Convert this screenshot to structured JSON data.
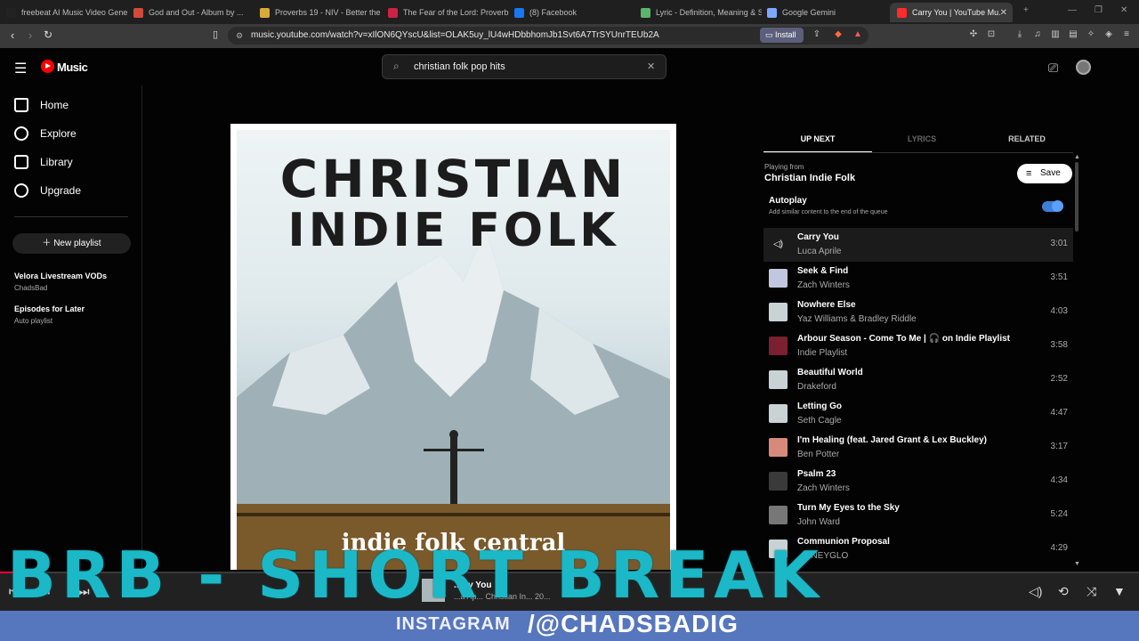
{
  "browser": {
    "tabs": [
      {
        "title": "freebeat AI Music Video Generator",
        "color": "#222222"
      },
      {
        "title": "God and Out - Album by ...",
        "color": "#d14a3a"
      },
      {
        "title": "Proverbs 19 - NIV - Better the...",
        "color": "#d9a93a"
      },
      {
        "title": "The Fear of the Lord: Proverbs",
        "color": "#cc2244"
      },
      {
        "title": "(8) Facebook",
        "color": "#1877f2"
      },
      {
        "title": "Lyric - Definition, Meaning & S...",
        "color": "#5bb56a"
      },
      {
        "title": "Google Gemini",
        "color": "#7ea7ff"
      },
      {
        "title": "Carry You | YouTube Mu...",
        "color": "#ff2b2b",
        "active": true
      }
    ],
    "url": "music.youtube.com/watch?v=xIlON6QYscU&list=OLAK5uy_lU4wHDbbhomJb1Svt6A7TrSYUnrTEUb2A",
    "install_label": "Install"
  },
  "app": {
    "logo_label": "Music",
    "search_query": "christian folk pop hits"
  },
  "sidebar": {
    "items": [
      {
        "label": "Home"
      },
      {
        "label": "Explore"
      },
      {
        "label": "Library"
      },
      {
        "label": "Upgrade"
      }
    ],
    "new_playlist": "New playlist",
    "playlists": [
      {
        "title": "Velora Livestream VODs",
        "sub": "ChadsBad"
      },
      {
        "title": "Episodes for Later",
        "sub": "Auto playlist"
      }
    ]
  },
  "cover": {
    "line1": "CHRISTIAN",
    "line2": "INDIE FOLK",
    "subtitle": "indie folk central"
  },
  "panel": {
    "tabs": [
      "UP NEXT",
      "LYRICS",
      "RELATED"
    ],
    "playing_from_label": "Playing from",
    "playing_from": "Christian Indie Folk",
    "save_label": "Save",
    "autoplay_title": "Autoplay",
    "autoplay_desc": "Add similar content to the end of the queue",
    "queue": [
      {
        "title": "Carry You",
        "artist": "Luca Aprile",
        "duration": "3:01",
        "current": true
      },
      {
        "title": "Seek & Find",
        "artist": "Zach Winters",
        "duration": "3:51"
      },
      {
        "title": "Nowhere Else",
        "artist": "Yaz Williams & Bradley Riddle",
        "duration": "4:03"
      },
      {
        "title": "Arbour Season - Come To Me | 🎧 on Indie Playlist",
        "artist": "Indie Playlist",
        "duration": "3:58"
      },
      {
        "title": "Beautiful World",
        "artist": "Drakeford",
        "duration": "2:52"
      },
      {
        "title": "Letting Go",
        "artist": "Seth Cagle",
        "duration": "4:47"
      },
      {
        "title": "I'm Healing (feat. Jared Grant & Lex Buckley)",
        "artist": "Ben Potter",
        "duration": "3:17"
      },
      {
        "title": "Psalm 23",
        "artist": "Zach Winters",
        "duration": "4:34"
      },
      {
        "title": "Turn My Eyes to the Sky",
        "artist": "John Ward",
        "duration": "5:24"
      },
      {
        "title": "Communion Proposal",
        "artist": "...RNEYGLO",
        "duration": "4:29"
      }
    ]
  },
  "player": {
    "title": "...rry You",
    "meta": "...a Ap... Christian In... 20...",
    "progress": 0.02
  },
  "overlay": {
    "brb_text": "BRB - SHORT BREAK",
    "instagram_label": "INSTAGRAM",
    "instagram_handle": "/@CHADSBADIG"
  }
}
